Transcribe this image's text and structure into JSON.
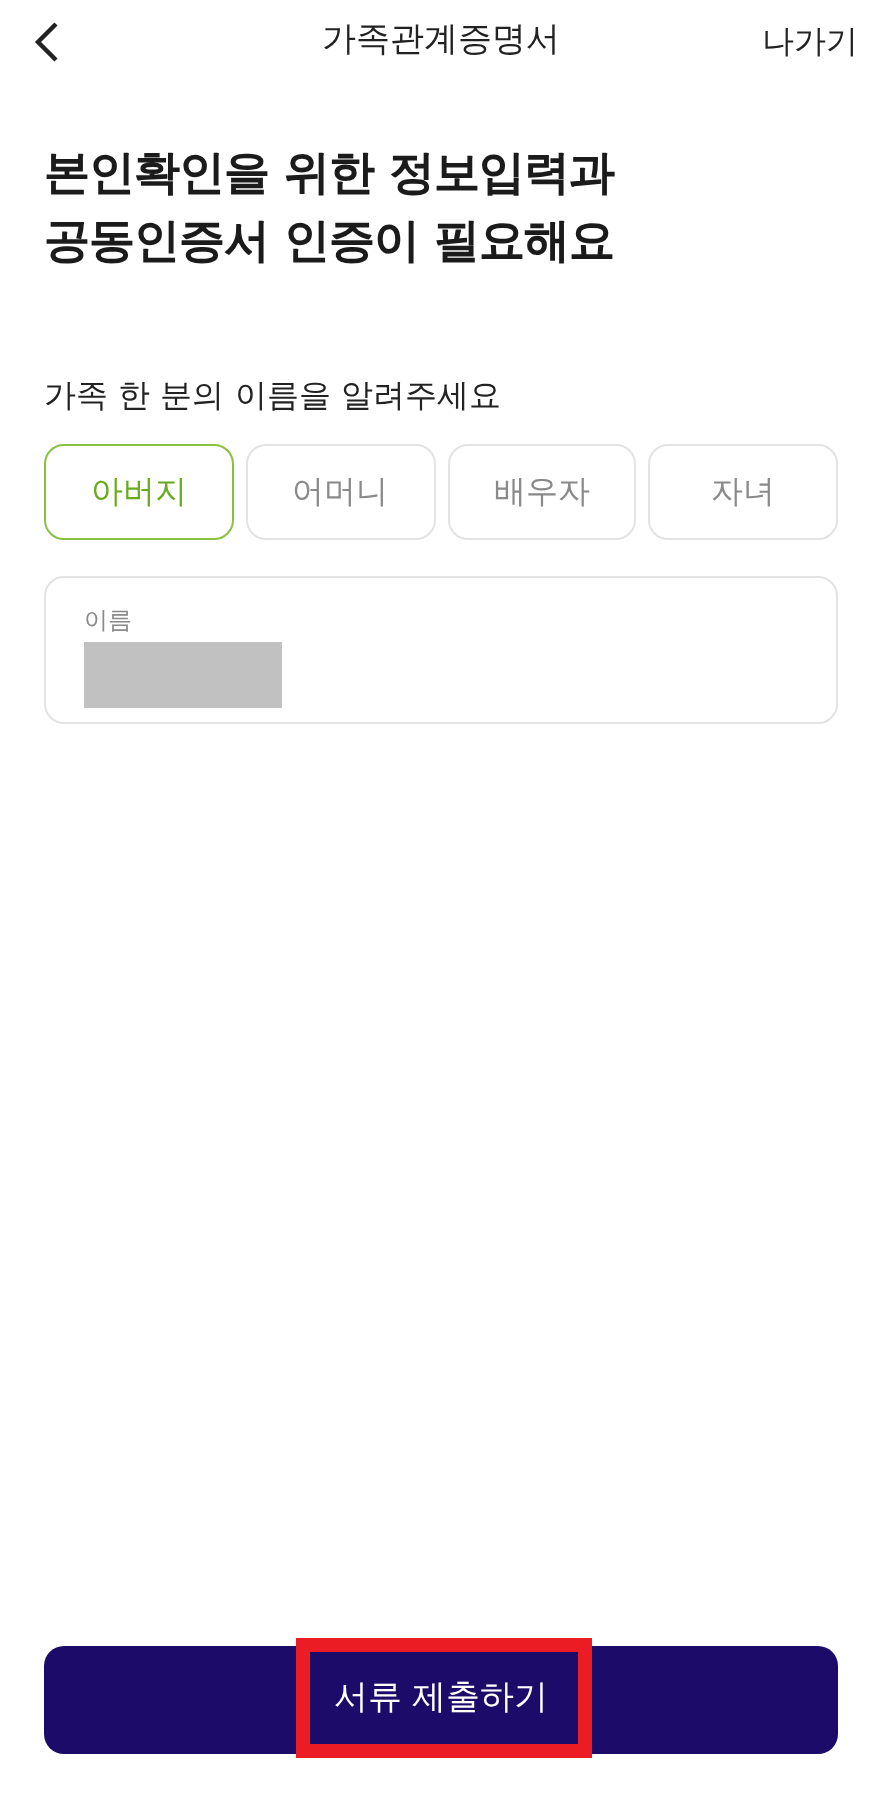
{
  "header": {
    "title": "가족관계증명서",
    "exit": "나가기"
  },
  "heading": [
    "본인확인을 위한 정보입력과",
    "공동인증서 인증이 필요해요"
  ],
  "prompt": "가족 한 분의 이름을 알려주세요",
  "relations": [
    {
      "label": "아버지",
      "selected": true
    },
    {
      "label": "어머니",
      "selected": false
    },
    {
      "label": "배우자",
      "selected": false
    },
    {
      "label": "자녀",
      "selected": false
    }
  ],
  "name_field": {
    "label": "이름",
    "redacted": true
  },
  "submit": {
    "label": "서류 제출하기",
    "highlighted": true
  }
}
